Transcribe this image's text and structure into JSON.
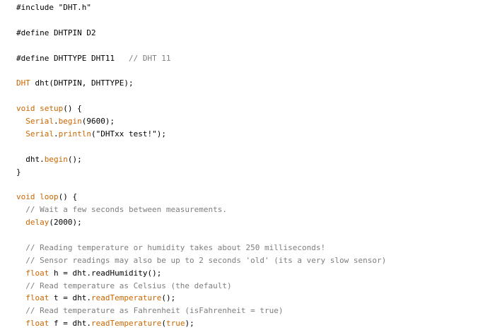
{
  "editor": {
    "colors": {
      "background": "#ffffff",
      "keyword": "#cc6600",
      "comment": "#7e7e7e",
      "text": "#000000"
    },
    "lines": [
      [
        {
          "t": "plain",
          "s": "#include \"DHT.h\""
        }
      ],
      [],
      [
        {
          "t": "plain",
          "s": "#define DHTPIN D2"
        }
      ],
      [],
      [
        {
          "t": "plain",
          "s": "#define DHTTYPE DHT11   "
        },
        {
          "t": "comment",
          "s": "// DHT 11"
        }
      ],
      [],
      [
        {
          "t": "class",
          "s": "DHT"
        },
        {
          "t": "plain",
          "s": " dht(DHTPIN, DHTTYPE);"
        }
      ],
      [],
      [
        {
          "t": "type",
          "s": "void"
        },
        {
          "t": "plain",
          "s": " "
        },
        {
          "t": "func",
          "s": "setup"
        },
        {
          "t": "plain",
          "s": "() {"
        }
      ],
      [
        {
          "t": "plain",
          "s": "  "
        },
        {
          "t": "class",
          "s": "Serial"
        },
        {
          "t": "plain",
          "s": "."
        },
        {
          "t": "func",
          "s": "begin"
        },
        {
          "t": "plain",
          "s": "(9600);"
        }
      ],
      [
        {
          "t": "plain",
          "s": "  "
        },
        {
          "t": "class",
          "s": "Serial"
        },
        {
          "t": "plain",
          "s": "."
        },
        {
          "t": "func",
          "s": "println"
        },
        {
          "t": "plain",
          "s": "(\"DHTxx test!\");"
        }
      ],
      [],
      [
        {
          "t": "plain",
          "s": "  dht."
        },
        {
          "t": "func",
          "s": "begin"
        },
        {
          "t": "plain",
          "s": "();"
        }
      ],
      [
        {
          "t": "plain",
          "s": "}"
        }
      ],
      [],
      [
        {
          "t": "type",
          "s": "void"
        },
        {
          "t": "plain",
          "s": " "
        },
        {
          "t": "func",
          "s": "loop"
        },
        {
          "t": "plain",
          "s": "() {"
        }
      ],
      [
        {
          "t": "plain",
          "s": "  "
        },
        {
          "t": "comment",
          "s": "// Wait a few seconds between measurements."
        }
      ],
      [
        {
          "t": "plain",
          "s": "  "
        },
        {
          "t": "func",
          "s": "delay"
        },
        {
          "t": "plain",
          "s": "(2000);"
        }
      ],
      [],
      [
        {
          "t": "plain",
          "s": "  "
        },
        {
          "t": "comment",
          "s": "// Reading temperature or humidity takes about 250 milliseconds!"
        }
      ],
      [
        {
          "t": "plain",
          "s": "  "
        },
        {
          "t": "comment",
          "s": "// Sensor readings may also be up to 2 seconds 'old' (its a very slow sensor)"
        }
      ],
      [
        {
          "t": "plain",
          "s": "  "
        },
        {
          "t": "type",
          "s": "float"
        },
        {
          "t": "plain",
          "s": " h = dht.readHumidity();"
        }
      ],
      [
        {
          "t": "plain",
          "s": "  "
        },
        {
          "t": "comment",
          "s": "// Read temperature as Celsius (the default)"
        }
      ],
      [
        {
          "t": "plain",
          "s": "  "
        },
        {
          "t": "type",
          "s": "float"
        },
        {
          "t": "plain",
          "s": " t = dht."
        },
        {
          "t": "func",
          "s": "readTemperature"
        },
        {
          "t": "plain",
          "s": "();"
        }
      ],
      [
        {
          "t": "plain",
          "s": "  "
        },
        {
          "t": "comment",
          "s": "// Read temperature as Fahrenheit (isFahrenheit = true)"
        }
      ],
      [
        {
          "t": "plain",
          "s": "  "
        },
        {
          "t": "type",
          "s": "float"
        },
        {
          "t": "plain",
          "s": " f = dht."
        },
        {
          "t": "func",
          "s": "readTemperature"
        },
        {
          "t": "plain",
          "s": "("
        },
        {
          "t": "type",
          "s": "true"
        },
        {
          "t": "plain",
          "s": ");"
        }
      ]
    ]
  }
}
